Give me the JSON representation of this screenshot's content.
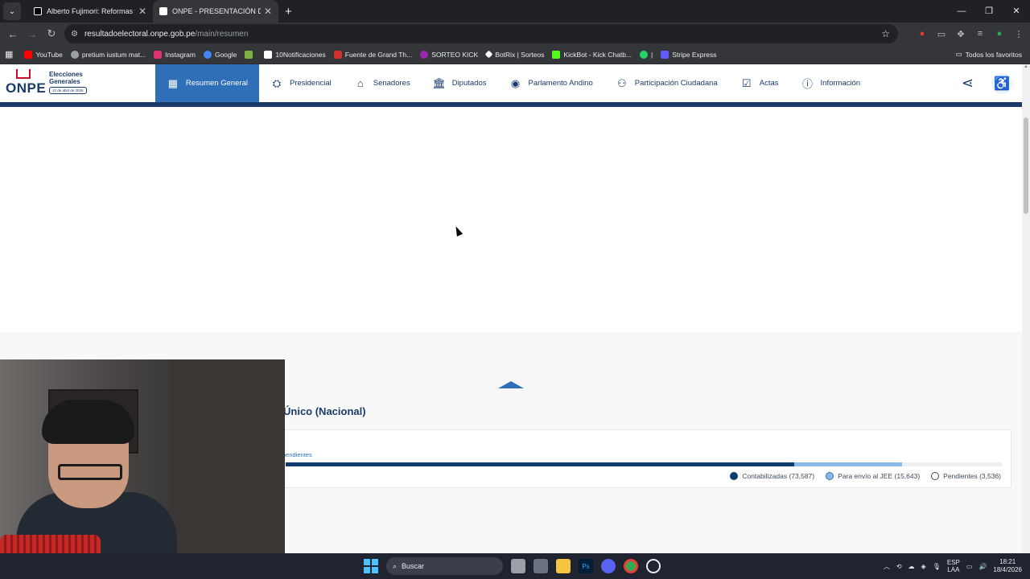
{
  "browser": {
    "tabs": [
      {
        "title": "Alberto Fujimori: Reformas y Ec",
        "active": false,
        "favicon": "tiktok-icon"
      },
      {
        "title": "ONPE - PRESENTACIÓN DE RES",
        "active": true,
        "favicon": "onpe-icon"
      }
    ],
    "url_domain": "resultadoelectoral.onpe.gob.pe",
    "url_path": "/main/resumen",
    "bookmarks": [
      {
        "label": "YouTube",
        "color": "#ff0000"
      },
      {
        "label": "pretium iustum mat...",
        "color": "#9aa0a6"
      },
      {
        "label": "Instagram",
        "color": "#e1306c"
      },
      {
        "label": "Google",
        "color": "#4285f4"
      },
      {
        "label": "",
        "color": "#7cb342"
      },
      {
        "label": "10Notificaciones",
        "color": "#ffffff"
      },
      {
        "label": "Fuente de Grand Th...",
        "color": "#d32f2f"
      },
      {
        "label": "SORTEO KICK",
        "color": "#9c27b0"
      },
      {
        "label": "BotRix | Sorteos",
        "color": "#ffffff"
      },
      {
        "label": "KickBot - Kick Chatb...",
        "color": "#53fc18"
      },
      {
        "label": "|",
        "color": "#25d366"
      },
      {
        "label": "Stripe Express",
        "color": "#635bff"
      }
    ],
    "bookmarks_all": "Todos los favoritos"
  },
  "site": {
    "logo_text": "ONPE",
    "logo_subtitle_1": "Elecciones",
    "logo_subtitle_2": "Generales",
    "logo_date": "12 de abril de 2026",
    "nav": [
      {
        "label": "Resumen General",
        "icon": "grid-icon",
        "active": true
      },
      {
        "label": "Presidencial",
        "icon": "seal-icon",
        "active": false
      },
      {
        "label": "Senadores",
        "icon": "senate-icon",
        "active": false
      },
      {
        "label": "Diputados",
        "icon": "building-icon",
        "active": false
      },
      {
        "label": "Parlamento Andino",
        "icon": "globe-icon",
        "active": false
      },
      {
        "label": "Participación Ciudadana",
        "icon": "people-icon",
        "active": false
      },
      {
        "label": "Actas",
        "icon": "clipboard-check-icon",
        "active": false
      },
      {
        "label": "Información",
        "icon": "info-doc-icon",
        "active": false
      }
    ]
  },
  "results": {
    "section_title": "Único (Nacional)",
    "pending_label": "pendientes",
    "progress": {
      "contabilizadas_fraction": 0.7099,
      "jee_fraction": 0.1509
    },
    "legend": [
      {
        "label": "Contabilizadas (73,587)",
        "color": "#0f3c6e"
      },
      {
        "label": "Para envío al JEE (15,643)",
        "color": "#8ab9e3"
      },
      {
        "label": "Pendientes (3,536)",
        "color": "#ffffff"
      }
    ]
  },
  "taskbar": {
    "search_placeholder": "Buscar",
    "lang_1": "ESP",
    "lang_2": "LAA",
    "time": "18:21",
    "date": "18/4/2026"
  }
}
